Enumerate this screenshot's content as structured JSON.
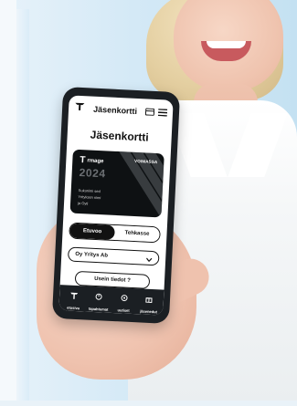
{
  "app": {
    "title": "Jäsenkortti",
    "heading": "Jäsenkortti"
  },
  "card": {
    "brand_letter": "T",
    "brand_word": "rmage",
    "status": "VOIMASSA",
    "year": "2024",
    "lines": [
      "Sukunimi sed",
      "Yrityksen nimi",
      "ja Oyti"
    ]
  },
  "toggle": {
    "left": "Etuvoo",
    "right": "Tehkasse"
  },
  "select": {
    "value": "Oy Yritys Ab"
  },
  "faq": {
    "label": "Usein tiedot ?"
  },
  "navbar": {
    "items": [
      "etusivu",
      "tapahtumat",
      "uutiset",
      "jäsenedut"
    ]
  }
}
